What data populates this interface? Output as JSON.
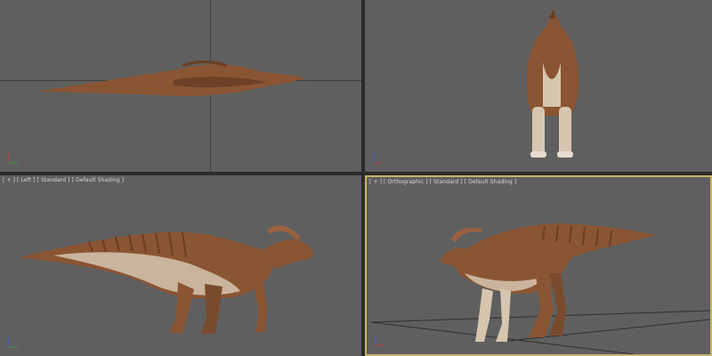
{
  "viewports": {
    "top_left": {
      "label": ""
    },
    "top_right": {
      "label": ""
    },
    "bottom_left": {
      "label": "[ + ] [ Left ] [ Standard ] [ Default Shading ]"
    },
    "bottom_right": {
      "label": "[ + ] [ Orthographic ] [ Standard ] [ Default Shading ]"
    }
  },
  "colors": {
    "viewport_bg": "#5f5f5f",
    "active_border": "#c7b267",
    "dino_body": "#8a5532",
    "dino_dark": "#5a3220",
    "dino_belly": "#d6c6b0"
  },
  "icons": [
    "axis-tripod-icon"
  ]
}
